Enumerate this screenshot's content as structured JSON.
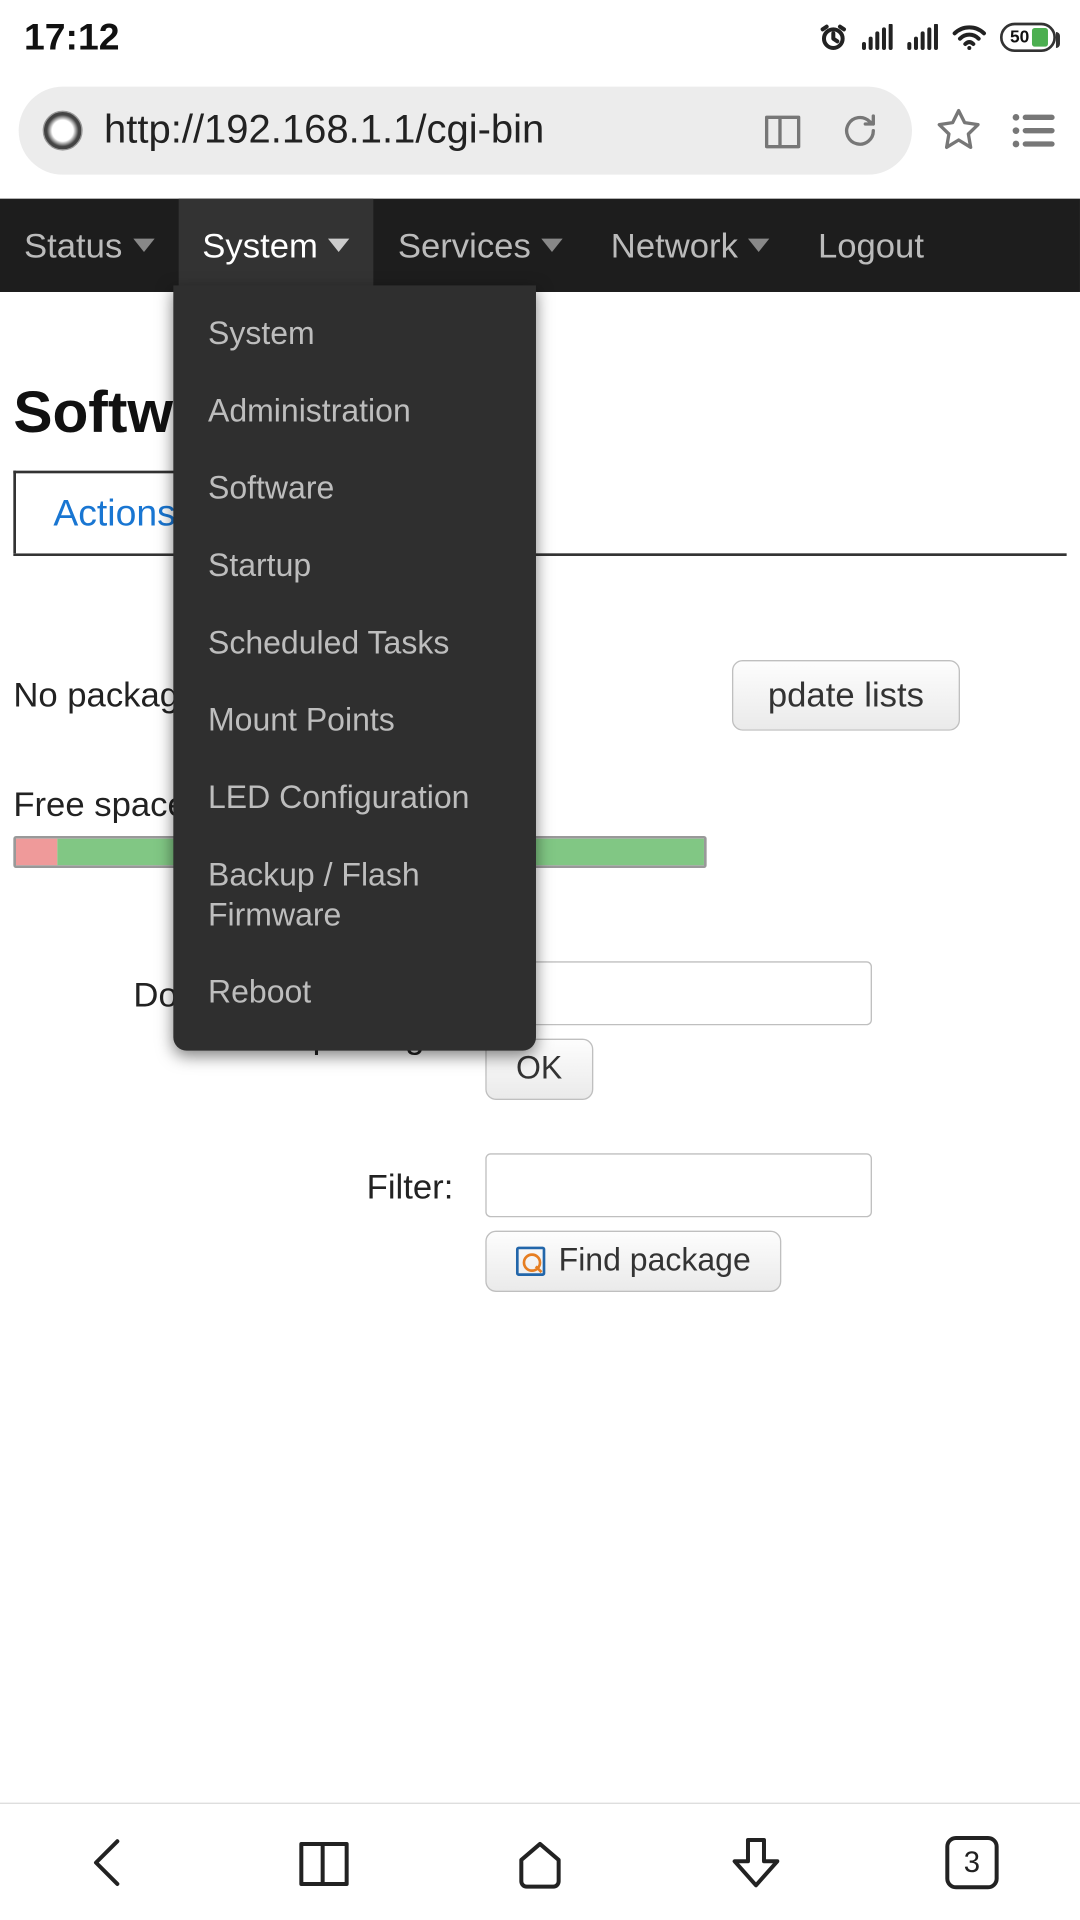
{
  "statusbar": {
    "time": "17:12",
    "battery_pct": "50"
  },
  "urlbar": {
    "url": "http://192.168.1.1/cgi-bin"
  },
  "nav": {
    "items": [
      {
        "label": "Status"
      },
      {
        "label": "System"
      },
      {
        "label": "Services"
      },
      {
        "label": "Network"
      },
      {
        "label": "Logout"
      }
    ]
  },
  "dropdown": {
    "items": [
      "System",
      "Administration",
      "Software",
      "Startup",
      "Scheduled Tasks",
      "Mount Points",
      "LED Configuration",
      "Backup / Flash Firmware",
      "Reboot"
    ]
  },
  "page": {
    "heading": "Softwa",
    "tab_label": "Actions",
    "no_package_text": "No package",
    "update_lists_btn": "pdate lists",
    "free_space_label": "Free space:",
    "progress_used_pct": 6,
    "download_label": "Download and install package:",
    "ok_btn": "OK",
    "filter_label": "Filter:",
    "find_btn": "Find package"
  },
  "bottombar": {
    "tab_count": "3"
  }
}
